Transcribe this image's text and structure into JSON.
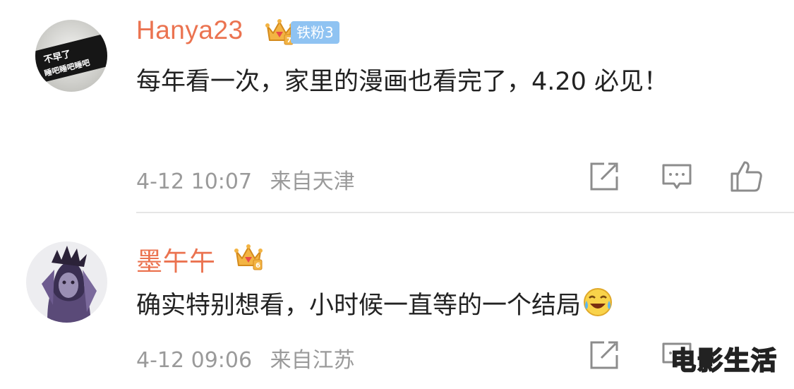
{
  "comments": [
    {
      "username": "Hanya23",
      "fan_badge": "铁粉3",
      "text": "每年看一次，家里的漫画也看完了，4.20 必见！",
      "date": "4-12 10:07",
      "location": "来自天津",
      "avatar_text": [
        "不早了",
        "睡吧睡吧睡吧"
      ]
    },
    {
      "username": "墨午午",
      "text": "确实特别想看，小时候一直等的一个结局",
      "date": "4-12 09:06",
      "location": "来自江苏"
    }
  ],
  "watermark": "电影生活",
  "colors": {
    "username": "#eb7350",
    "body_text": "#222222",
    "meta_text": "#9a9a9a",
    "fan_badge_bg": "#8fc3f2",
    "crown_gold": "#f3b443",
    "divider": "#e6e6e6"
  }
}
